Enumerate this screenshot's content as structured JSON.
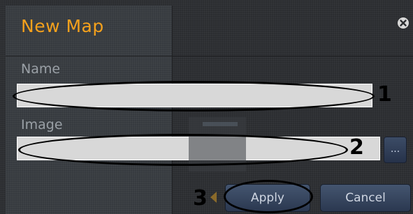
{
  "dialog": {
    "title": "New Map",
    "title_color": "#f5a11c",
    "close_icon": "close-icon"
  },
  "form": {
    "name_label": "Name",
    "name_value": "",
    "image_label": "Image",
    "image_value": "",
    "browse_label": "..."
  },
  "buttons": {
    "apply_label": "Apply",
    "cancel_label": "Cancel"
  },
  "annotations": {
    "marker_1": "1",
    "marker_2": "2",
    "marker_3": "3"
  }
}
